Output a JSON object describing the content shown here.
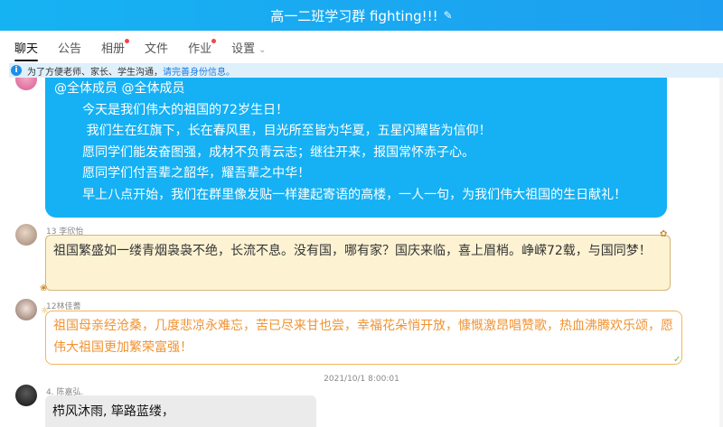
{
  "title": "高一二班学习群 fighting!!!",
  "tabs": [
    {
      "label": "聊天",
      "active": true
    },
    {
      "label": "公告"
    },
    {
      "label": "相册",
      "dot": true
    },
    {
      "label": "文件"
    },
    {
      "label": "作业",
      "dot": true
    },
    {
      "label": "设置"
    }
  ],
  "notice": {
    "text": "为了方便老师、家长、学生沟通，",
    "link": "请完善身份信息。"
  },
  "messages": [
    {
      "lines": [
        "@全体成员 @全体成员",
        "       今天是我们伟大的祖国的72岁生日！",
        "        我们生在红旗下，长在春风里，目光所至皆为华夏，五星闪耀皆为信仰！",
        "       愿同学们能发奋图强，成材不负青云志；继往开来，报国常怀赤子心。",
        "       愿同学们付吾辈之韶华，耀吾辈之中华！",
        "       早上八点开始，我们在群里像发贴一样建起寄语的高楼，一人一句，为我们伟大祖国的生日献礼！"
      ]
    },
    {
      "sender": "13 李欣怡",
      "text": "祖国繁盛如一缕青烟袅袅不绝，长流不息。没有国，哪有家？国庆来临，喜上眉梢。峥嵘72载，与国同梦！"
    },
    {
      "sender": "12林佳蓍",
      "text": "祖国母亲经沧桑，几度悲凉永难忘，苦已尽来甘也尝，幸福花朵悄开放，慷慨激昂唱赞歌，热血沸腾欢乐颂，愿伟大祖国更加繁荣富强！"
    },
    {
      "timestamp": "2021/10/1 8:00:01"
    },
    {
      "sender": "4. 陈嘉弘.",
      "text": "栉风沐雨, 筚路蓝缕，"
    }
  ]
}
